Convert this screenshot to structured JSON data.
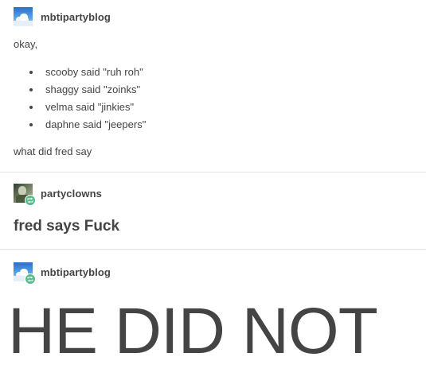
{
  "posts": [
    {
      "username": "mbtipartyblog",
      "avatar": "sky-clouds-avatar",
      "intro": "okay,",
      "items": [
        "scooby said \"ruh roh\"",
        "shaggy said \"zoinks\"",
        "velma said \"jinkies\"",
        "daphne said \"jeepers\""
      ],
      "outro": "what did fred say"
    },
    {
      "username": "partyclowns",
      "avatar": "photo-avatar",
      "reblog_icon": "reblog-icon",
      "text": "fred says Fuck"
    },
    {
      "username": "mbtipartyblog",
      "avatar": "sky-clouds-avatar",
      "reblog_icon": "reblog-icon",
      "text": "HE DID NOT"
    }
  ],
  "colors": {
    "text": "#444444",
    "reblog_badge": "#56bc8a",
    "divider": "#e4e4e4"
  }
}
